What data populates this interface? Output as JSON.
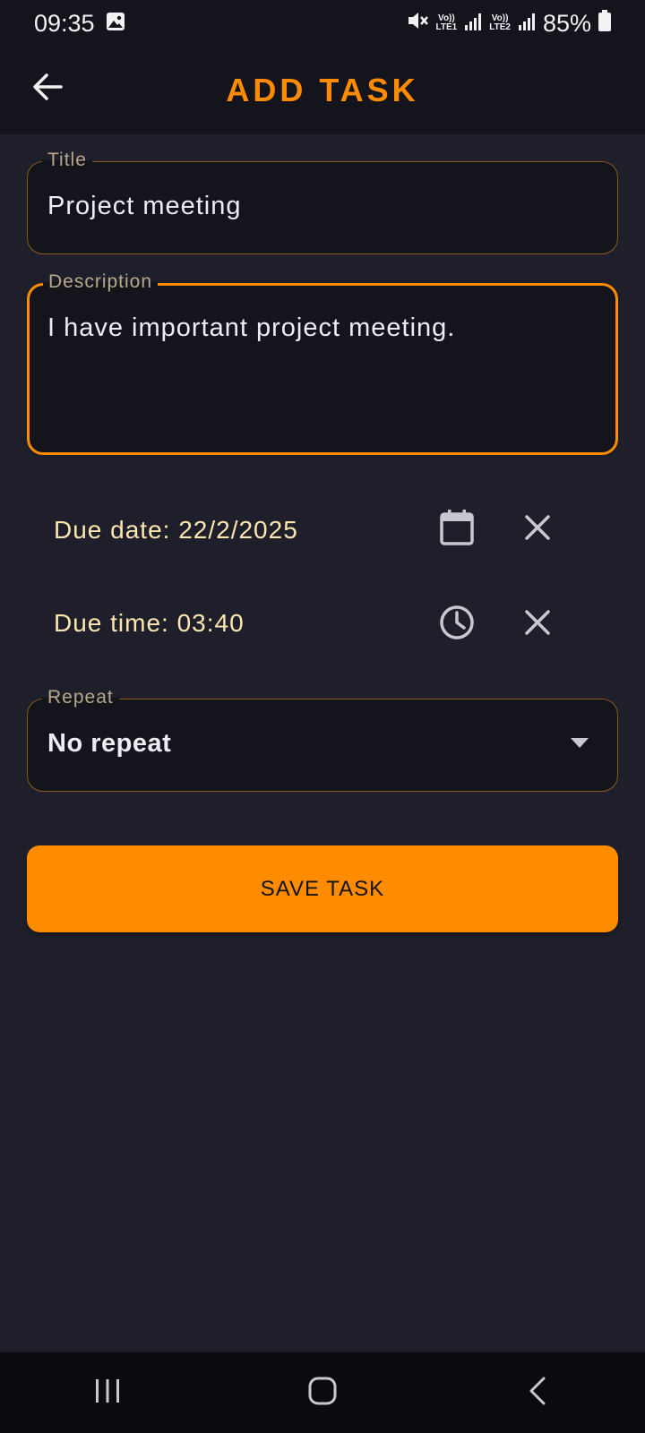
{
  "status_bar": {
    "time": "09:35",
    "battery": "85%",
    "sim1": "Vo))\nLTE1",
    "sim2": "Vo))\nLTE2",
    "icons": [
      "gallery-icon",
      "mute-icon",
      "signal-icon",
      "battery-icon"
    ]
  },
  "app_bar": {
    "title": "ADD TASK",
    "back_icon": "arrow-back-icon"
  },
  "form": {
    "title_label": "Title",
    "title_value": "Project meeting",
    "description_label": "Description",
    "description_value": "I have important project meeting.",
    "due_date_text": "Due date: 22/2/2025",
    "due_time_text": "Due time: 03:40",
    "repeat_label": "Repeat",
    "repeat_value": "No repeat",
    "save_label": "SAVE TASK"
  },
  "colors": {
    "accent": "#ff8c00",
    "background": "#1f1f2b",
    "surface": "#14141d",
    "due_text": "#fbe6b0"
  },
  "nav_bar": {
    "icons": [
      "recent-apps-icon",
      "home-icon",
      "back-nav-icon"
    ]
  }
}
